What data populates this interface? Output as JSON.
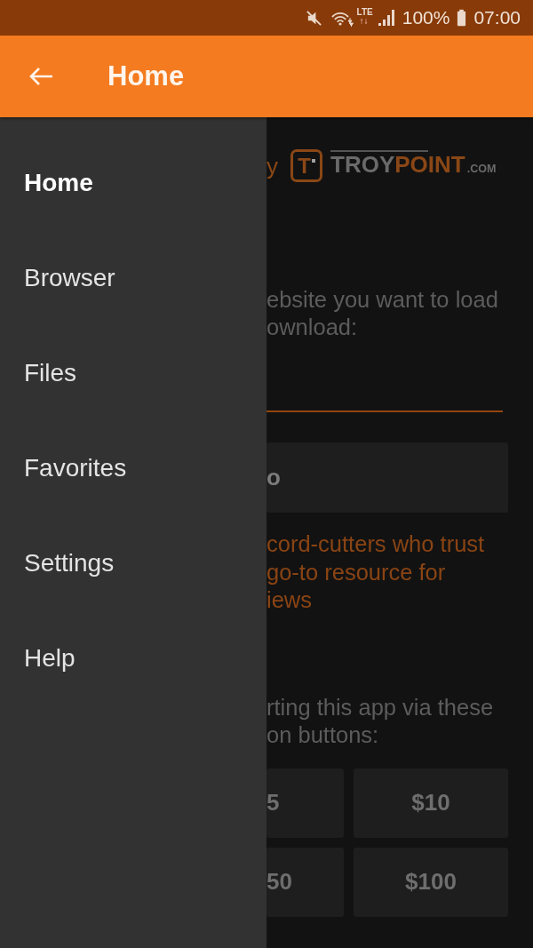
{
  "status_bar": {
    "muted": true,
    "network_type": "LTE",
    "battery": "100%",
    "time": "07:00"
  },
  "app_bar": {
    "title": "Home"
  },
  "drawer": {
    "items": [
      {
        "label": "Home",
        "selected": true
      },
      {
        "label": "Browser",
        "selected": false
      },
      {
        "label": "Files",
        "selected": false
      },
      {
        "label": "Favorites",
        "selected": false
      },
      {
        "label": "Settings",
        "selected": false
      },
      {
        "label": "Help",
        "selected": false
      }
    ]
  },
  "content": {
    "logo": {
      "prefix": "y",
      "mark": "T",
      "wordmark": [
        {
          "text": "TROY",
          "kind": "word",
          "color": "#6a6a6a"
        },
        {
          "text": "POINT",
          "kind": "word",
          "color": "#8a4716"
        },
        {
          "text": ".COM",
          "kind": "suffix",
          "color": "#6a6a6a"
        }
      ]
    },
    "instructions": [
      "ebsite you want to load",
      "ownload:"
    ],
    "url_field": {
      "focused": true
    },
    "action_button": {
      "label": "o"
    },
    "promo_lines": [
      "cord-cutters who trust",
      "go-to resource for",
      "iews"
    ],
    "support_lines": [
      "rting this app via these",
      "on buttons:"
    ],
    "donation_buttons": [
      {
        "label": "5"
      },
      {
        "label": "$10"
      },
      {
        "label": "50"
      },
      {
        "label": "$100"
      }
    ]
  }
}
